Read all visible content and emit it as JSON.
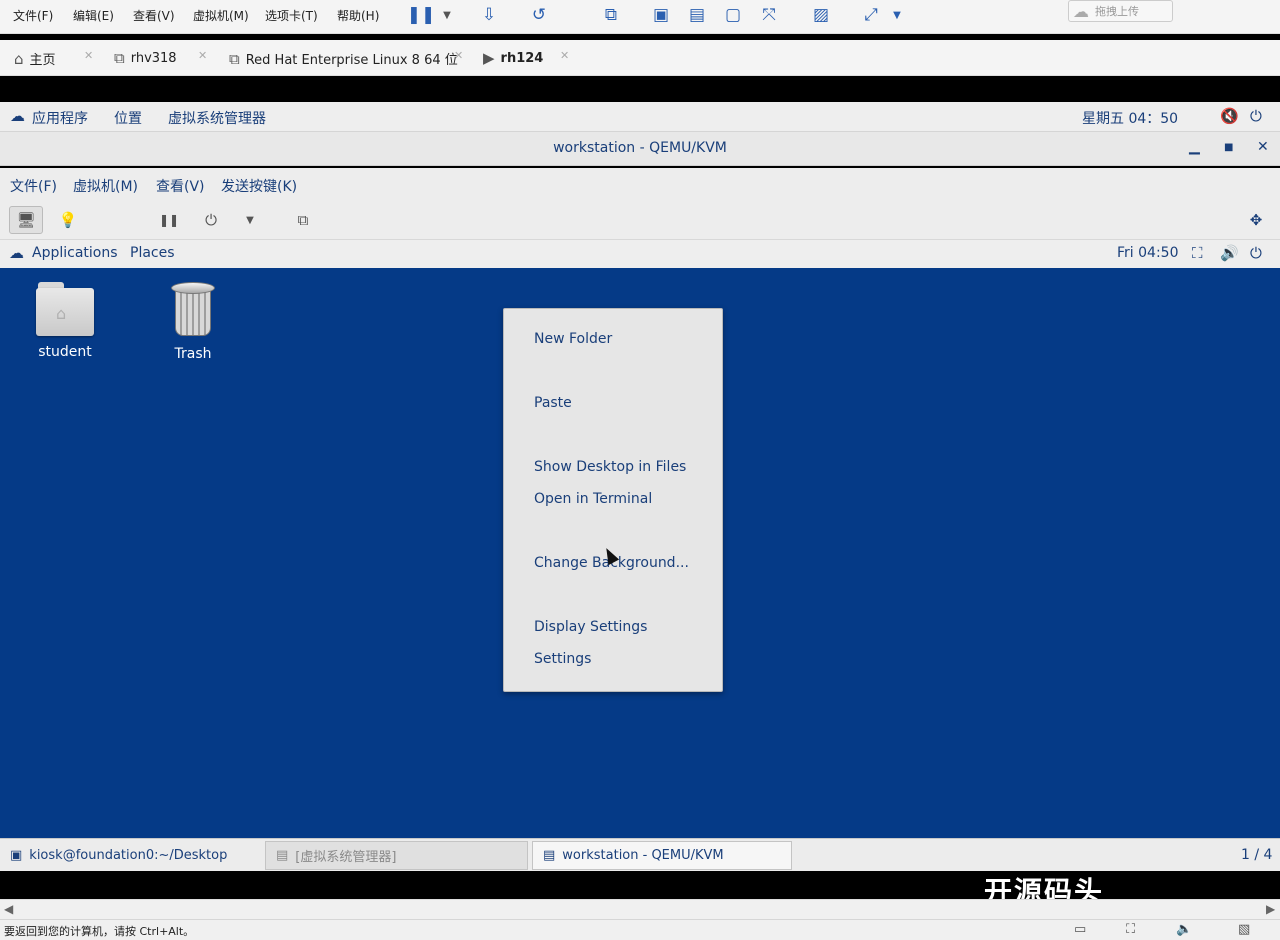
{
  "host_menubar": {
    "items": [
      "文件(F)",
      "编辑(E)",
      "查看(V)",
      "虚拟机(M)",
      "选项卡(T)",
      "帮助(H)"
    ],
    "upload_label": "拖拽上传"
  },
  "host_tabs": {
    "home": "主页",
    "tab1": "rhv318",
    "tab2": "Red Hat Enterprise Linux 8 64 位",
    "tab3": "rh124"
  },
  "host_topbar": {
    "applications": "应用程序",
    "places": "位置",
    "virt_manager": "虚拟系统管理器",
    "clock": "星期五 04：50"
  },
  "viewer": {
    "title": "workstation - QEMU/KVM",
    "menu": [
      "文件(F)",
      "虚拟机(M)",
      "查看(V)",
      "发送按键(K)"
    ]
  },
  "guest_topbar": {
    "applications": "Applications",
    "places": "Places",
    "clock": "Fri 04:50"
  },
  "desktop": {
    "icons": [
      {
        "label": "student",
        "icon": "home-folder-icon"
      },
      {
        "label": "Trash",
        "icon": "trash-icon"
      }
    ],
    "background": "#053a87"
  },
  "context_menu": {
    "items": [
      "New Folder",
      "Paste",
      "Show Desktop in Files",
      "Open in Terminal",
      "Change Background...",
      "Display Settings",
      "Settings"
    ]
  },
  "taskbar": {
    "tasks": [
      "kiosk@foundation0:~/Desktop",
      "[虚拟系统管理器]",
      "workstation - QEMU/KVM"
    ],
    "workspace": "1 / 4"
  },
  "watermark": "开源码头",
  "status": {
    "message": "要返回到您的计算机，请按 Ctrl+Alt。"
  },
  "colors": {
    "accent_text": "#1a3f7a",
    "desktop_blue": "#053a87",
    "menu_bg": "#e6e6e6"
  }
}
